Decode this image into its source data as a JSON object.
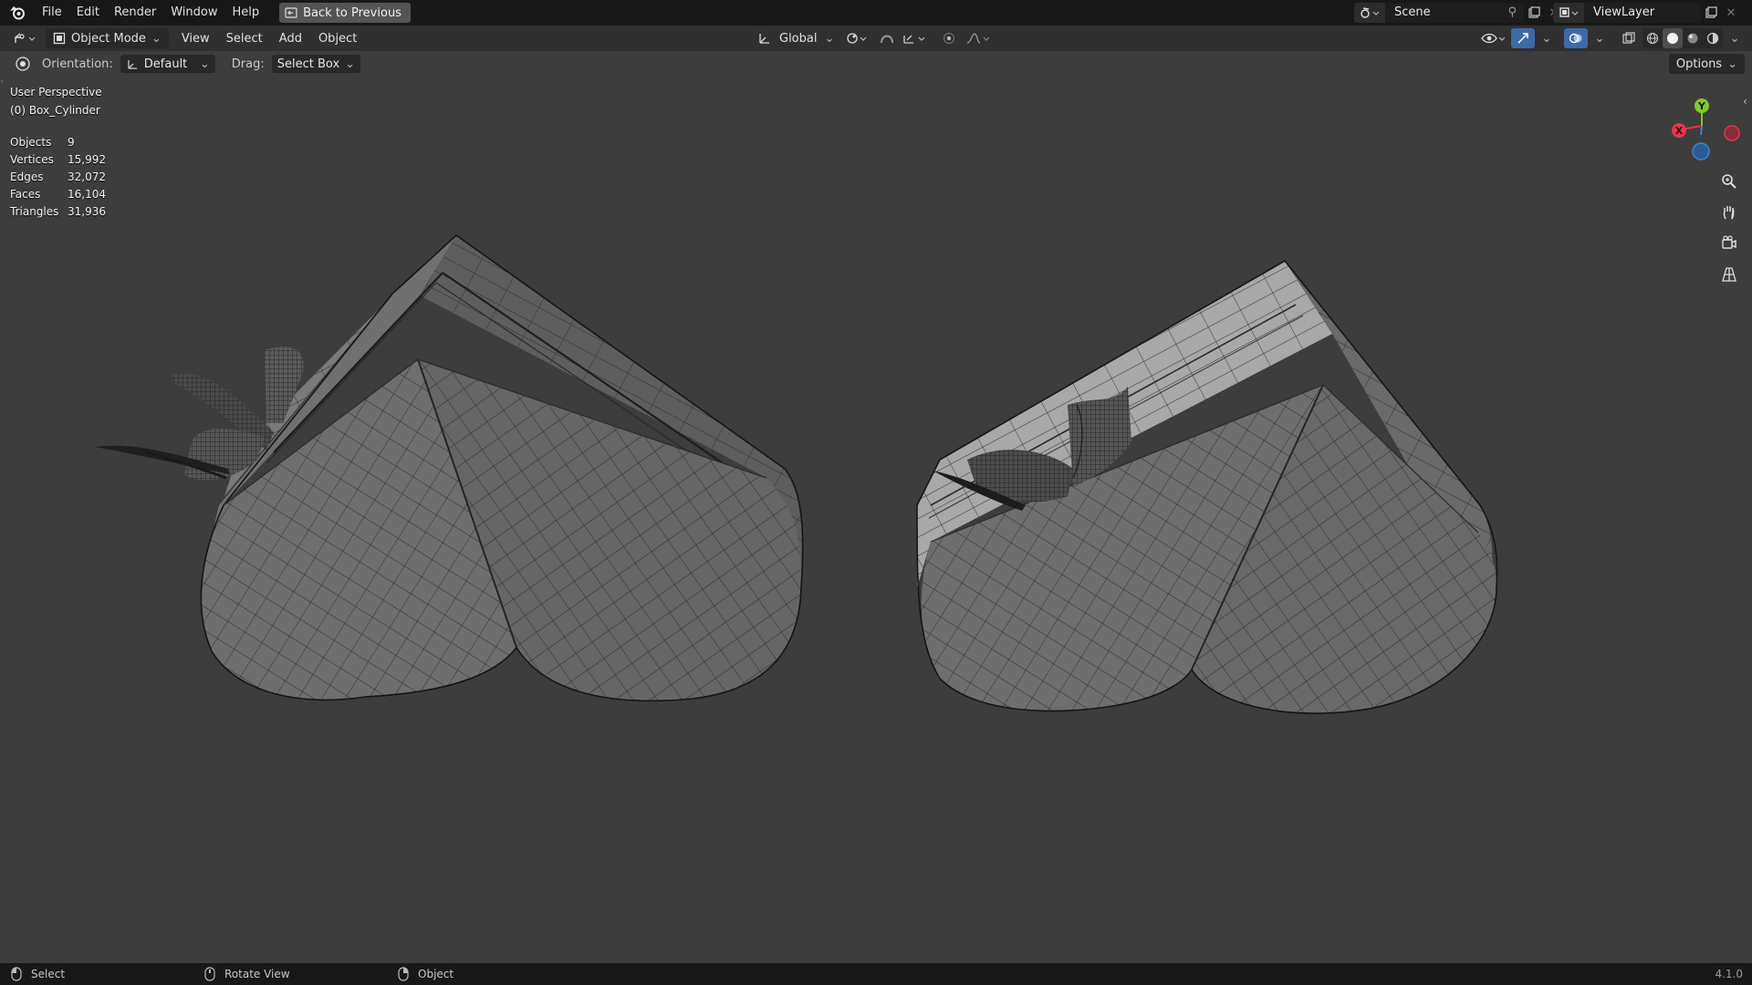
{
  "menu": {
    "items": [
      "File",
      "Edit",
      "Render",
      "Window",
      "Help"
    ],
    "back_button": "Back to Previous"
  },
  "scene": {
    "name": "Scene"
  },
  "view_layer": {
    "name": "ViewLayer"
  },
  "header": {
    "mode": "Object Mode",
    "menus": [
      "View",
      "Select",
      "Add",
      "Object"
    ],
    "transform_orientation": "Global"
  },
  "tool_settings": {
    "orientation_label": "Orientation:",
    "orientation_value": "Default",
    "drag_label": "Drag:",
    "drag_value": "Select Box",
    "options_label": "Options"
  },
  "viewport": {
    "perspective": "User Perspective",
    "active_object": "(0) Box_Cylinder",
    "stats": [
      {
        "label": "Objects",
        "value": "9"
      },
      {
        "label": "Vertices",
        "value": "15,992"
      },
      {
        "label": "Edges",
        "value": "32,072"
      },
      {
        "label": "Faces",
        "value": "16,104"
      },
      {
        "label": "Triangles",
        "value": "31,936"
      }
    ],
    "gizmo": {
      "x_label": "X",
      "y_label": "Y",
      "x_color": "#e8344f",
      "y_color": "#7fcb27",
      "z_color": "#3b83d6"
    }
  },
  "statusbar": {
    "items": [
      "Select",
      "Rotate View",
      "Object"
    ],
    "version": "4.1.0"
  }
}
